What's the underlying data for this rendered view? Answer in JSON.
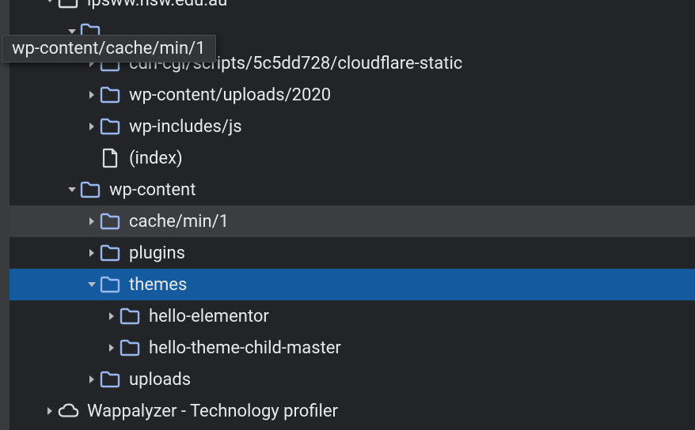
{
  "tooltip": "wp-content/cache/min/1",
  "rows": [
    {
      "indent": 42,
      "toggle": "down",
      "icon": "folder-outline",
      "label": "ipsww.nsw.edu.au"
    },
    {
      "indent": 70,
      "toggle": "down",
      "icon": "folder",
      "label": ""
    },
    {
      "indent": 95,
      "toggle": "right",
      "icon": "folder",
      "label": "cdn-cgi/scripts/5c5dd728/cloudflare-static"
    },
    {
      "indent": 95,
      "toggle": "right",
      "icon": "folder",
      "label": "wp-content/uploads/2020"
    },
    {
      "indent": 95,
      "toggle": "right",
      "icon": "folder",
      "label": "wp-includes/js"
    },
    {
      "indent": 95,
      "toggle": "none",
      "icon": "file",
      "label": "(index)"
    },
    {
      "indent": 70,
      "toggle": "down",
      "icon": "folder",
      "label": "wp-content"
    },
    {
      "indent": 95,
      "toggle": "right",
      "icon": "folder",
      "label": "cache/min/1",
      "state": "hover"
    },
    {
      "indent": 95,
      "toggle": "right",
      "icon": "folder",
      "label": "plugins"
    },
    {
      "indent": 95,
      "toggle": "down",
      "icon": "folder",
      "label": "themes",
      "state": "selected"
    },
    {
      "indent": 120,
      "toggle": "right",
      "icon": "folder",
      "label": "hello-elementor"
    },
    {
      "indent": 120,
      "toggle": "right",
      "icon": "folder",
      "label": "hello-theme-child-master"
    },
    {
      "indent": 95,
      "toggle": "right",
      "icon": "folder",
      "label": "uploads"
    },
    {
      "indent": 42,
      "toggle": "right",
      "icon": "cloud",
      "label": "Wappalyzer - Technology profiler"
    }
  ]
}
